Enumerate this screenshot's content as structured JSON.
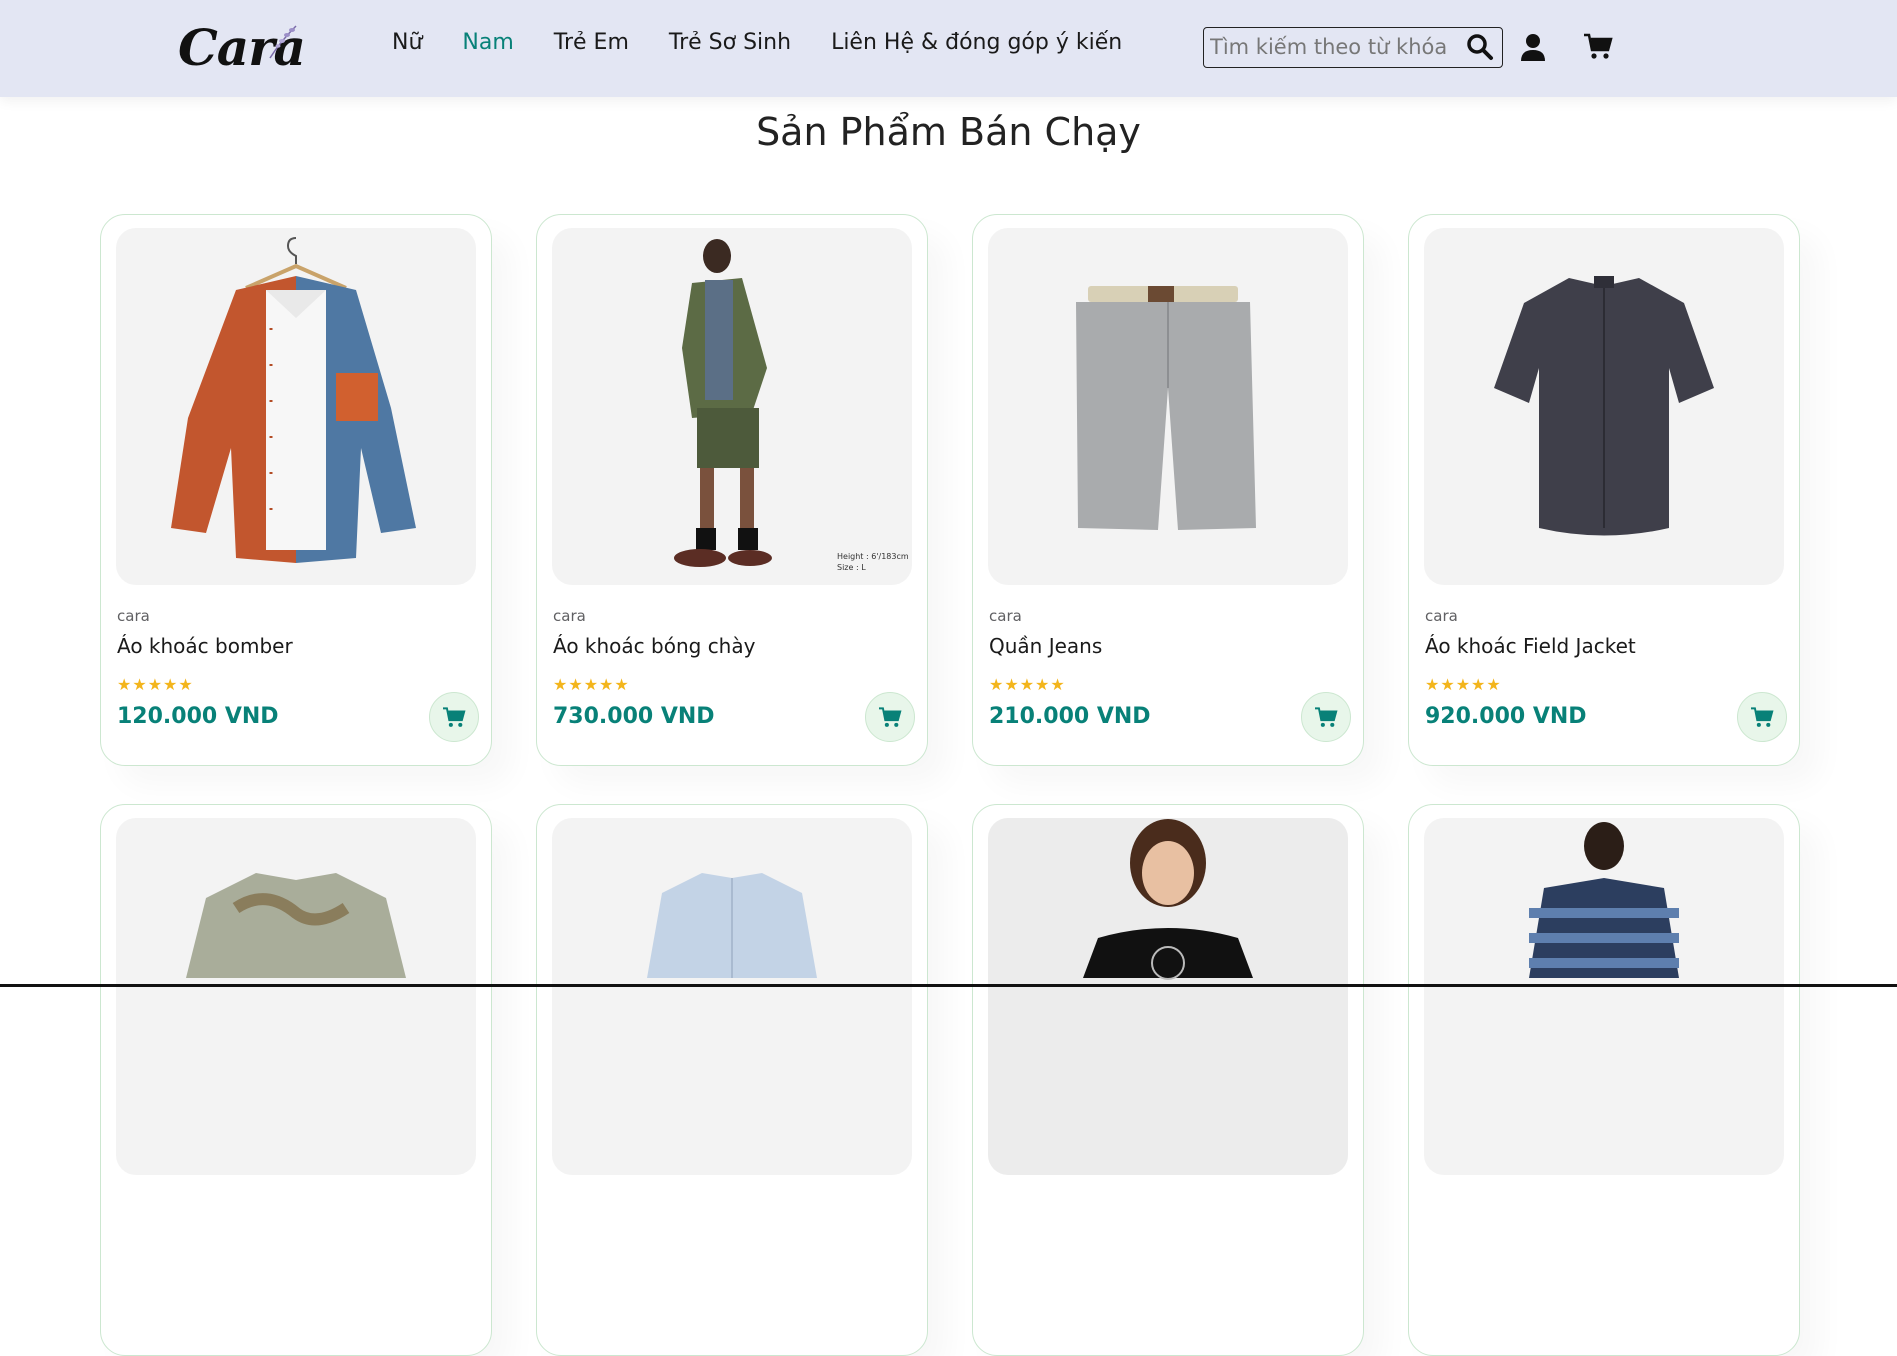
{
  "header": {
    "logo": "Cara",
    "nav": [
      "Nữ",
      "Nam",
      "Trẻ Em",
      "Trẻ Sơ Sinh",
      "Liên Hệ & đóng góp ý kiến"
    ],
    "active_nav": "Nam",
    "search_placeholder": "Tìm kiếm theo từ khóa",
    "icons": [
      "search-icon",
      "user-icon",
      "cart-icon"
    ]
  },
  "section": {
    "title": "Sản Phẩm Bán Chạy"
  },
  "products": [
    {
      "brand": "cara",
      "name": "Áo khoác bomber",
      "stars": "★★★★★",
      "price": "120.000 VND"
    },
    {
      "brand": "cara",
      "name": "Áo khoác bóng chày",
      "stars": "★★★★★",
      "price": "730.000 VND",
      "photo_caption": [
        "Height : 6'/183cm",
        "Size : L"
      ]
    },
    {
      "brand": "cara",
      "name": "Quần Jeans",
      "stars": "★★★★★",
      "price": "210.000 VND"
    },
    {
      "brand": "cara",
      "name": "Áo khoác Field Jacket",
      "stars": "★★★★★",
      "price": "920.000 VND"
    },
    {
      "brand": "",
      "name": "",
      "stars": "",
      "price": ""
    },
    {
      "brand": "",
      "name": "",
      "stars": "",
      "price": ""
    },
    {
      "brand": "",
      "name": "",
      "stars": "",
      "price": ""
    },
    {
      "brand": "",
      "name": "",
      "stars": "",
      "price": ""
    }
  ],
  "colors": {
    "accent": "#088178",
    "header_bg": "#e3e6f3",
    "star": "#f3b51c",
    "card_border": "#cce7d0"
  }
}
